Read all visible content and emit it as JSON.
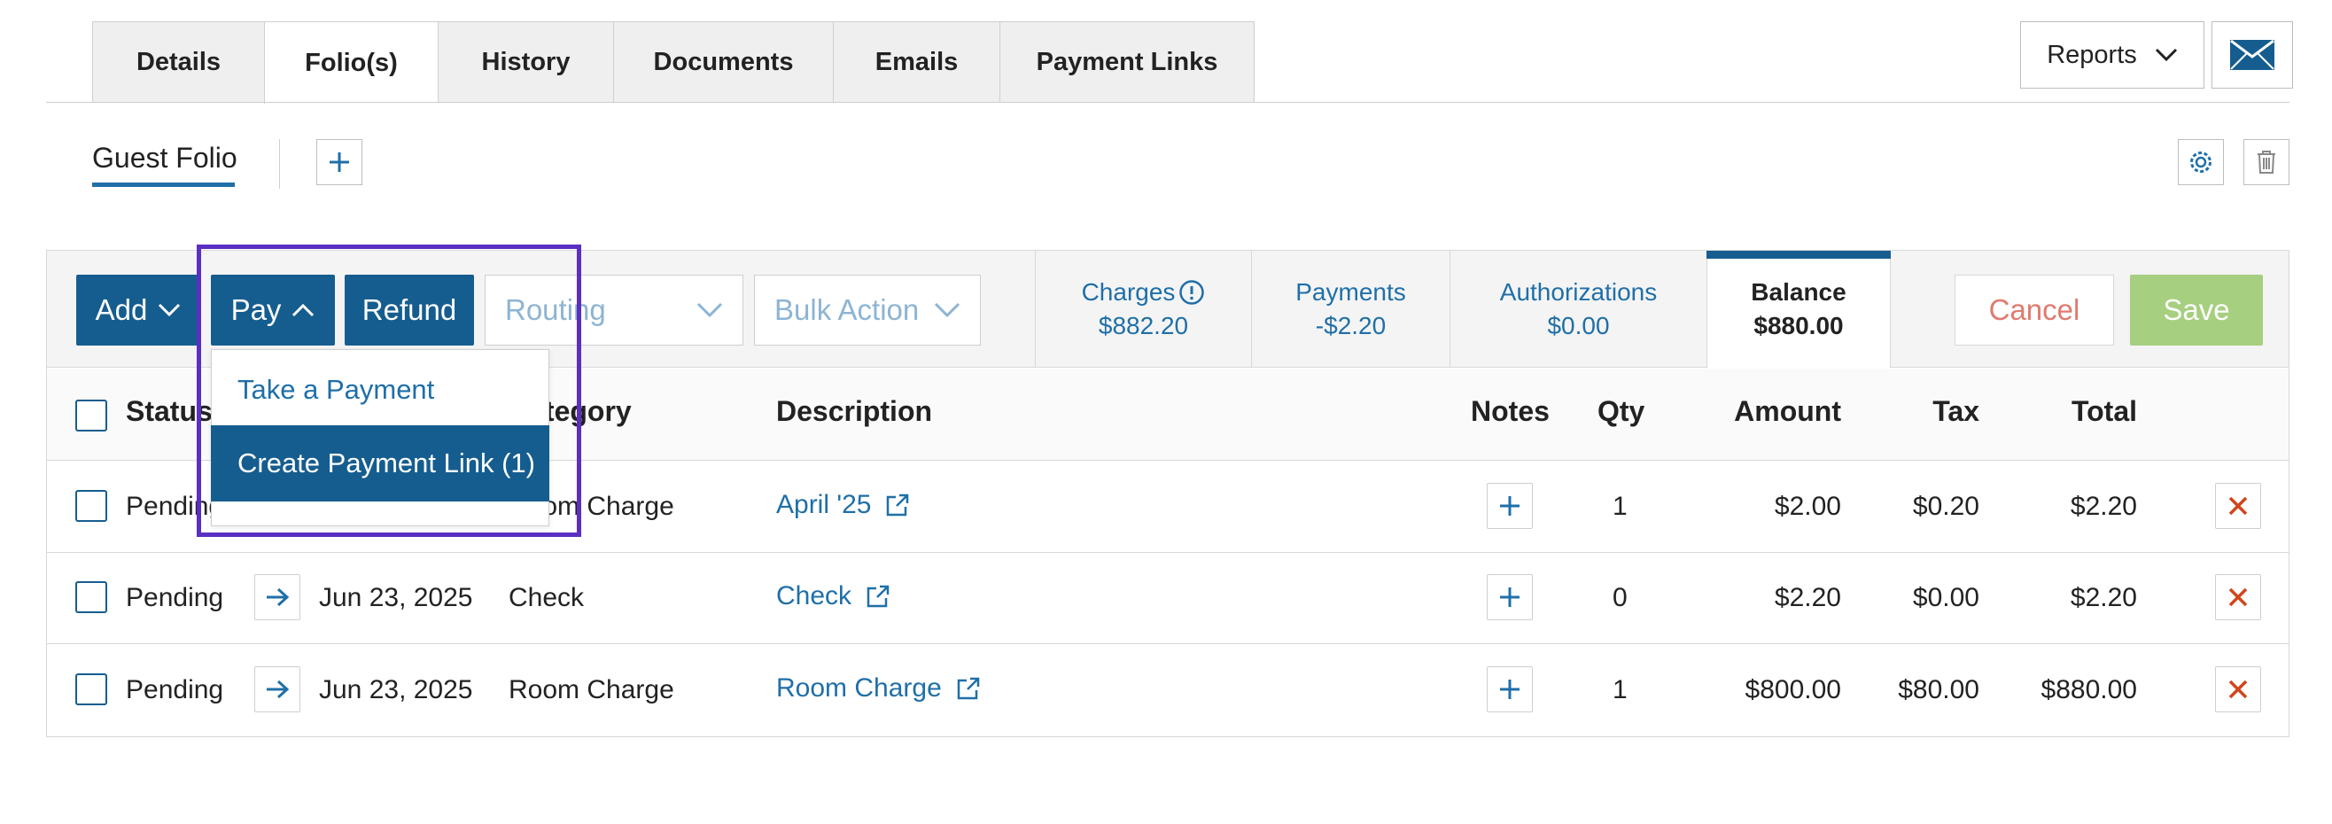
{
  "tabs": [
    {
      "label": "Details"
    },
    {
      "label": "Folio(s)"
    },
    {
      "label": "History"
    },
    {
      "label": "Documents"
    },
    {
      "label": "Emails"
    },
    {
      "label": "Payment Links"
    }
  ],
  "reports_label": "Reports",
  "folio": {
    "title": "Guest Folio"
  },
  "toolbar": {
    "add_label": "Add",
    "pay_label": "Pay",
    "refund_label": "Refund",
    "routing_placeholder": "Routing",
    "bulk_action_placeholder": "Bulk Action",
    "cancel_label": "Cancel",
    "save_label": "Save"
  },
  "summary": {
    "charges_label": "Charges",
    "charges_value": "$882.20",
    "payments_label": "Payments",
    "payments_value": "-$2.20",
    "authorizations_label": "Authorizations",
    "authorizations_value": "$0.00",
    "balance_label": "Balance",
    "balance_value": "$880.00"
  },
  "columns": {
    "status": "Status",
    "category": "Category",
    "description": "Description",
    "notes": "Notes",
    "qty": "Qty",
    "amount": "Amount",
    "tax": "Tax",
    "total": "Total"
  },
  "rows": [
    {
      "status": "Pending",
      "date": "",
      "category": "Room Charge",
      "description": "April '25",
      "qty": "1",
      "amount": "$2.00",
      "tax": "$0.20",
      "total": "$2.20"
    },
    {
      "status": "Pending",
      "date": "Jun 23, 2025",
      "category": "Check",
      "description": "Check",
      "qty": "0",
      "amount": "$2.20",
      "tax": "$0.00",
      "total": "$2.20"
    },
    {
      "status": "Pending",
      "date": "Jun 23, 2025",
      "category": "Room Charge",
      "description": "Room Charge",
      "qty": "1",
      "amount": "$800.00",
      "tax": "$80.00",
      "total": "$880.00"
    }
  ],
  "pay_menu": {
    "items": [
      "Take a Payment",
      "Create Payment Link (1)"
    ]
  },
  "colors": {
    "primary": "#165d8f",
    "link": "#1f6fa8",
    "save": "#a6cf7f",
    "cancel": "#e07a6f",
    "delete": "#d0451b",
    "highlight": "#5a2fc2"
  }
}
